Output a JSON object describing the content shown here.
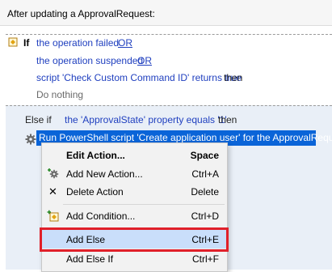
{
  "header": {
    "title": "After updating a ApprovalRequest:"
  },
  "if_block": {
    "keyword": "If",
    "conditions": [
      {
        "text": "the operation failed",
        "op": "OR"
      },
      {
        "text": "the operation suspended",
        "op": "OR"
      },
      {
        "text": "script 'Check Custom Command ID' returns true",
        "suffix": "then"
      }
    ],
    "action": "Do nothing"
  },
  "else_block": {
    "keyword": "Else if",
    "condition": "the 'ApprovalState' property equals '1'",
    "suffix": "then",
    "action": "Run PowerShell script 'Create application user' for the ApprovalRequest"
  },
  "context_menu": {
    "items": [
      {
        "label": "Edit Action...",
        "shortcut": "Space",
        "icon": "none",
        "bold": true
      },
      {
        "label": "Add New Action...",
        "shortcut": "Ctrl+A",
        "icon": "gear-add-icon"
      },
      {
        "label": "Delete Action",
        "shortcut": "Delete",
        "icon": "close-icon"
      },
      {
        "label": "Add Condition...",
        "shortcut": "Ctrl+D",
        "icon": "condition-add-icon"
      },
      {
        "label": "Add Else",
        "shortcut": "Ctrl+E",
        "icon": "none",
        "highlighted": true
      },
      {
        "label": "Add Else If",
        "shortcut": "Ctrl+F",
        "icon": "none"
      }
    ]
  },
  "colors": {
    "link_blue": "#1f3fbf",
    "selection": "#0a64d8",
    "else_panel": "#e9eff7",
    "menu_highlight": "#c9defa",
    "annotation_red": "#e0202a"
  }
}
